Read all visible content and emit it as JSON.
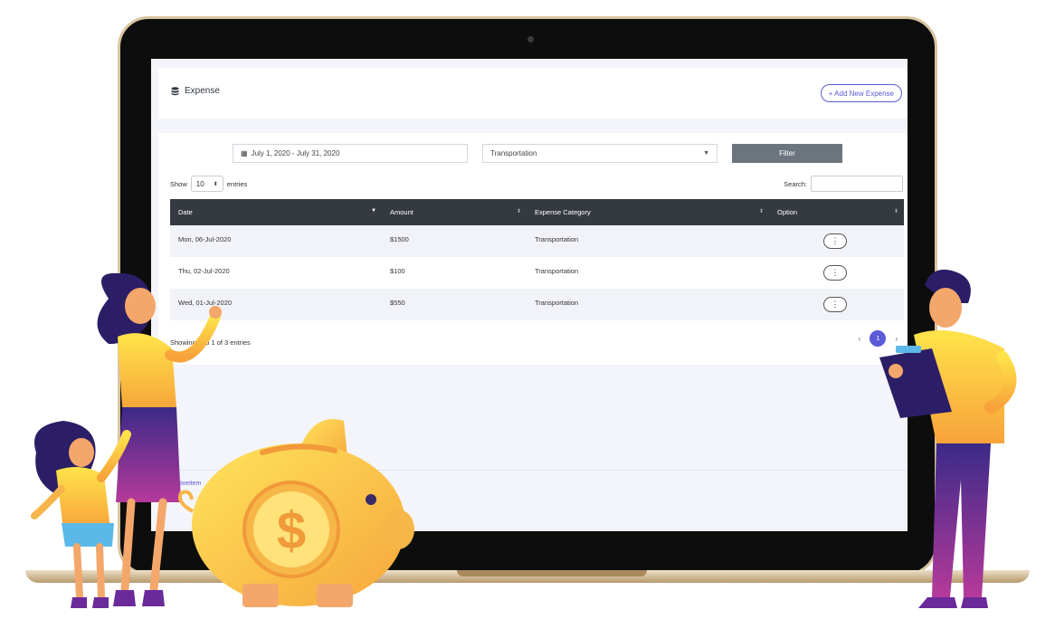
{
  "header": {
    "title": "Expense",
    "add_button": "+ Add New Expense"
  },
  "filters": {
    "date_range": "July 1, 2020 - July 31, 2020",
    "category": "Transportation",
    "filter_button": "Filter"
  },
  "table_controls": {
    "show_label": "Show",
    "length_value": "10",
    "entries_label": "entries",
    "search_label": "Search:"
  },
  "table": {
    "columns": [
      "Date",
      "Amount",
      "Expense Category",
      "Option"
    ],
    "rows": [
      {
        "date": "Mon, 06-Jul-2020",
        "amount": "$1500",
        "category": "Transportation"
      },
      {
        "date": "Thu, 02-Jul-2020",
        "amount": "$100",
        "category": "Transportation"
      },
      {
        "date": "Wed, 01-Jul-2020",
        "amount": "$550",
        "category": "Transportation"
      }
    ]
  },
  "pagination": {
    "info": "Showing 1 to 1 of 3 entries",
    "prev": "‹",
    "current_page": "1",
    "next": "›"
  },
  "footer": {
    "link_text": "Creativeitem"
  },
  "illustration": {
    "coin_symbol": "$"
  },
  "colors": {
    "accent": "#5b5bd6",
    "table_header": "#343a40",
    "filter_button": "#6c757d"
  }
}
